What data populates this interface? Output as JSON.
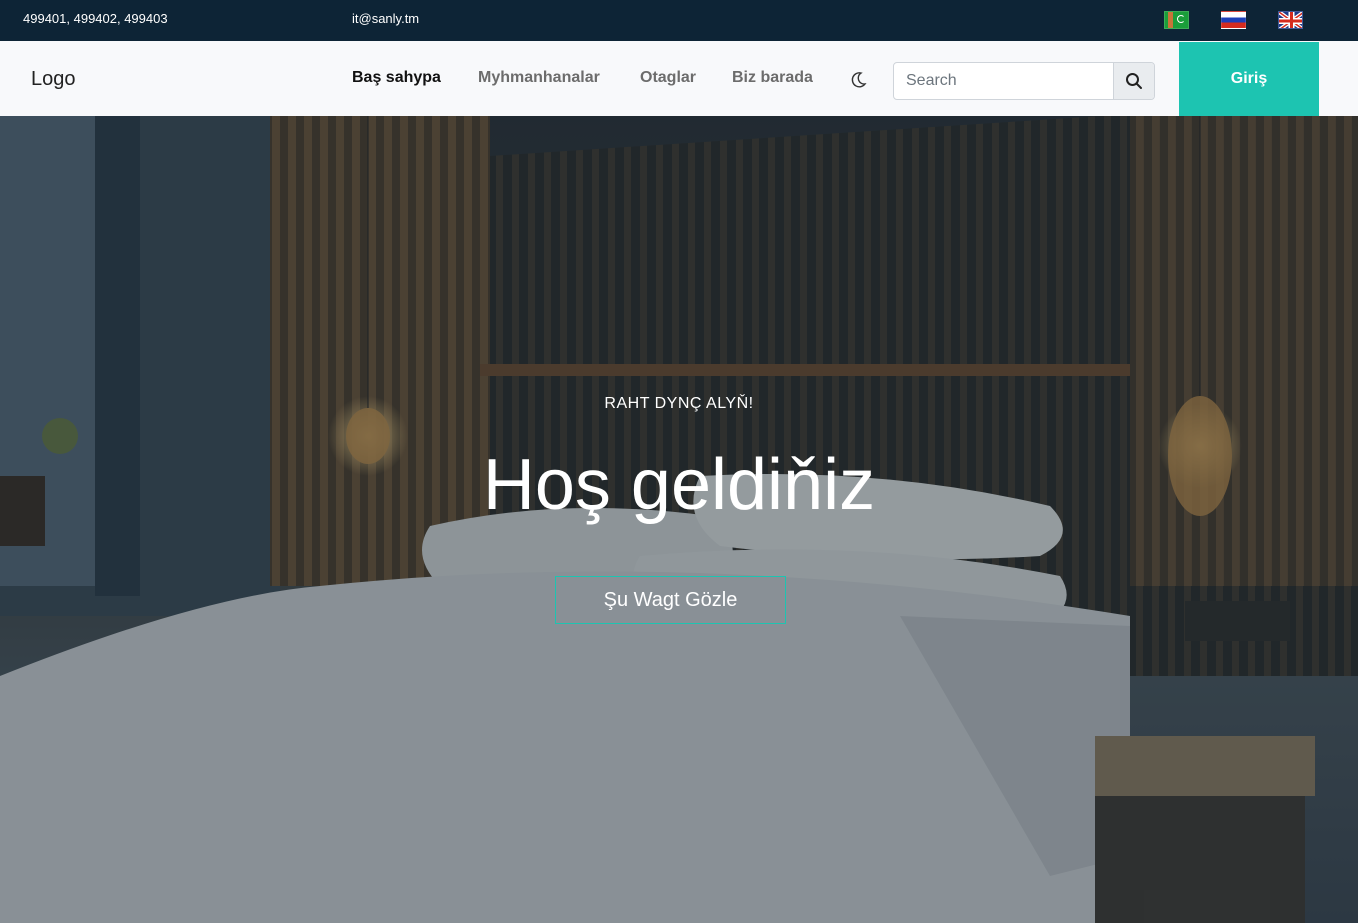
{
  "topbar": {
    "phones": "499401, 499402, 499403",
    "email": "it@sanly.tm",
    "languages": [
      {
        "name": "turkmen-flag-icon"
      },
      {
        "name": "russian-flag-icon"
      },
      {
        "name": "uk-flag-icon"
      }
    ]
  },
  "navbar": {
    "logo": "Logo",
    "links": [
      "Baş sahypa",
      "Myhmanhanalar",
      "Otaglar",
      "Biz barada"
    ],
    "theme_icon": "moon-icon",
    "search": {
      "placeholder": "Search",
      "value": "",
      "icon": "search-icon"
    },
    "login_label": "Giriş"
  },
  "hero": {
    "subtitle": "RAHT DYNÇ ALYŇ!",
    "title": "Hoş geldiňiz",
    "cta_label": "Şu Wagt Gözle"
  },
  "colors": {
    "topbar_bg": "#0d2436",
    "navbar_bg": "#f8f9fb",
    "accent": "#1dc4b1"
  }
}
